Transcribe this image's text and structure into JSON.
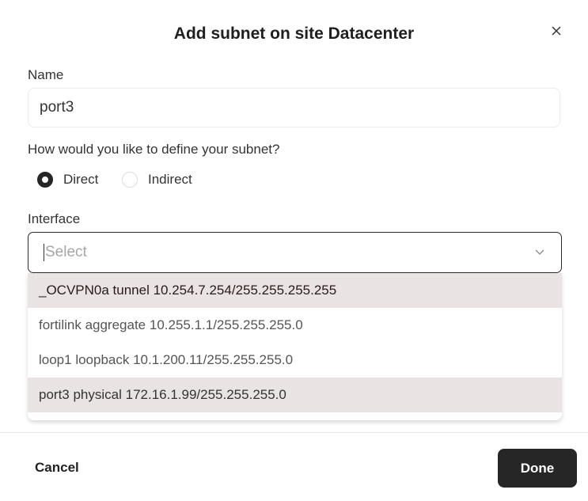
{
  "dialog": {
    "title": "Add subnet on site Datacenter",
    "name_label": "Name",
    "name_value": "port3",
    "define_label": "How would you like to define your subnet?",
    "radios": [
      {
        "label": "Direct",
        "checked": true
      },
      {
        "label": "Indirect",
        "checked": false
      }
    ],
    "interface_label": "Interface",
    "interface_placeholder": "Select",
    "options": [
      "_OCVPN0a tunnel 10.254.7.254/255.255.255.255",
      "fortilink aggregate 10.255.1.1/255.255.255.0",
      "loop1 loopback 10.1.200.11/255.255.255.0",
      "port3 physical 172.16.1.99/255.255.255.0"
    ],
    "cancel_label": "Cancel",
    "done_label": "Done"
  }
}
